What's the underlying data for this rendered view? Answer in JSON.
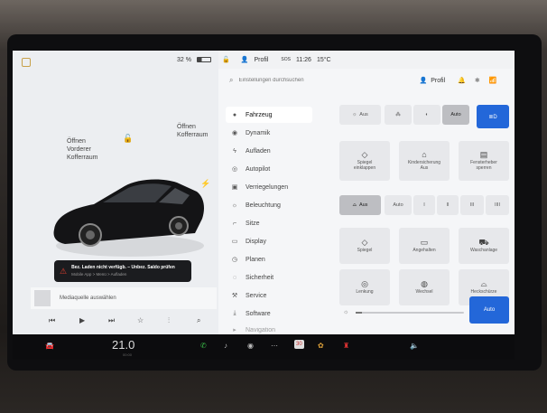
{
  "status_bar": {
    "battery": "32 %",
    "profile": "Profil",
    "sos": "SOS",
    "time": "11:26",
    "temperature": "15°C"
  },
  "car_view": {
    "frunk_open": "Öffnen",
    "frunk_name": "Vorderer\nKofferraum",
    "trunk_open": "Öffnen",
    "trunk_name": "Kofferraum",
    "alert_line1": "Bez. Laden nicht verfügb. – Unbez. Saldo prüfen",
    "alert_line2": "Mobile App > Menü > Aufladen"
  },
  "media": {
    "source_label": "Mediaquelle auswählen"
  },
  "search": {
    "placeholder": "Einstellungen durchsuchen",
    "profile_label": "Profil"
  },
  "menu": [
    {
      "icon": "car-icon",
      "label": "Fahrzeug",
      "active": true
    },
    {
      "icon": "speedometer-icon",
      "label": "Dynamik"
    },
    {
      "icon": "bolt-icon",
      "label": "Aufladen"
    },
    {
      "icon": "steering-wheel-icon",
      "label": "Autopilot"
    },
    {
      "icon": "lock-icon",
      "label": "Verriegelungen"
    },
    {
      "icon": "sun-icon",
      "label": "Beleuchtung"
    },
    {
      "icon": "seat-icon",
      "label": "Sitze"
    },
    {
      "icon": "display-icon",
      "label": "Display"
    },
    {
      "icon": "calendar-icon",
      "label": "Planen"
    },
    {
      "icon": "shield-icon",
      "label": "Sicherheit"
    },
    {
      "icon": "wrench-icon",
      "label": "Service"
    },
    {
      "icon": "download-icon",
      "label": "Software"
    },
    {
      "icon": "more-icon",
      "label": "Navigation"
    }
  ],
  "lights_row": {
    "aus": "Aus",
    "auto": "Auto"
  },
  "tiles_row1": [
    {
      "icon": "mirror-icon",
      "label": "Spiegel\neinklappen"
    },
    {
      "icon": "child-lock-icon",
      "label": "Kindersicherung\nAus"
    },
    {
      "icon": "window-icon",
      "label": "Fensterheber\nsperren"
    }
  ],
  "wiper_row": {
    "aus": "Aus",
    "auto": "Auto",
    "s1": "I",
    "s2": "II",
    "s3": "III",
    "s4": "IIII"
  },
  "tiles_row2": [
    {
      "icon": "mirror-adjust-icon",
      "label": "Spiegel"
    },
    {
      "icon": "display-icon",
      "label": "Angehalten"
    },
    {
      "icon": "car-wash-icon",
      "label": "Waschanlage"
    }
  ],
  "tiles_row3": [
    {
      "icon": "steering-wheel-icon",
      "label": "Lenkung"
    },
    {
      "icon": "wheel-icon",
      "label": "Wechsel"
    },
    {
      "icon": "headlight-adjust-icon",
      "label": "Heckschürze"
    }
  ],
  "bottom": {
    "auto_button": "Auto"
  },
  "taskbar": {
    "temperature": "21.0",
    "sub": "00:00",
    "calendar_day": "30"
  }
}
